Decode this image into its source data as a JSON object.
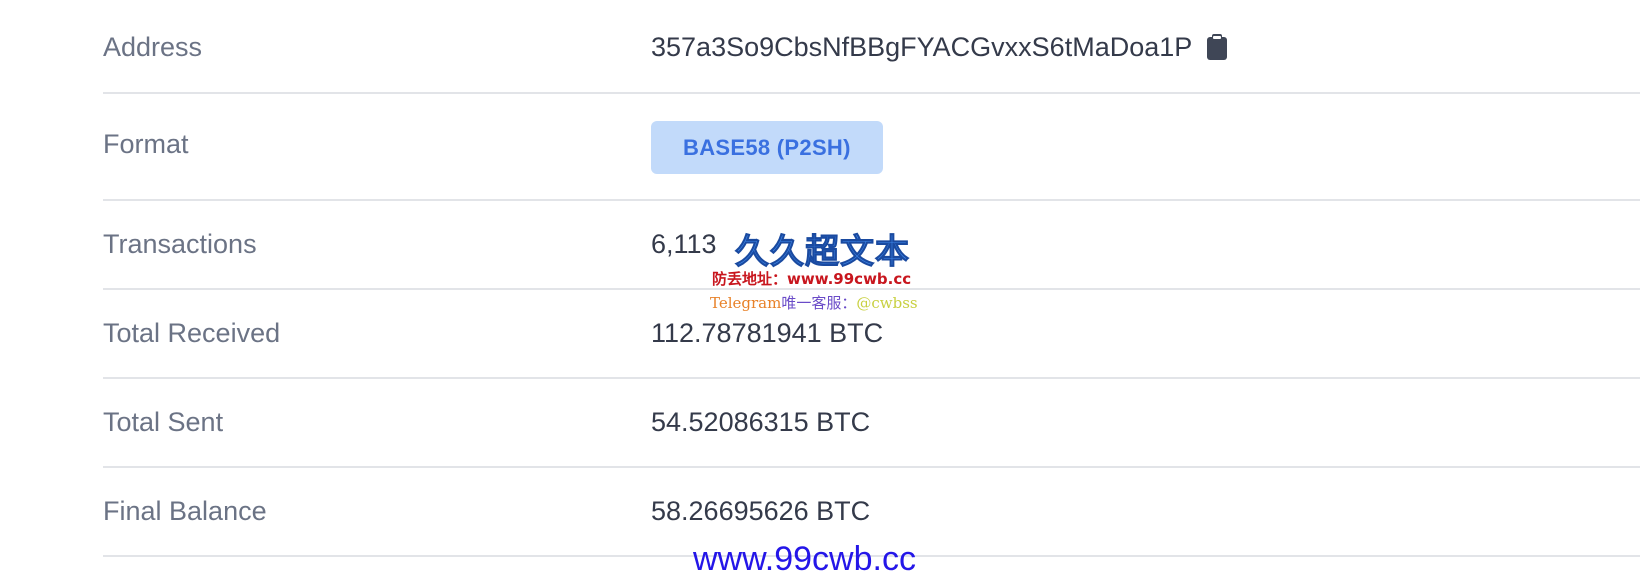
{
  "rows": [
    {
      "label": "Address",
      "value": "357a3So9CbsNfBBgFYACGvxxS6tMaDoa1P"
    },
    {
      "label": "Format",
      "value": "BASE58 (P2SH)"
    },
    {
      "label": "Transactions",
      "value": "6,113"
    },
    {
      "label": "Total Received",
      "value": "112.78781941 BTC"
    },
    {
      "label": "Total Sent",
      "value": "54.52086315 BTC"
    },
    {
      "label": "Final Balance",
      "value": "58.26695626 BTC"
    }
  ],
  "icons": {
    "copy": "clipboard-icon"
  },
  "colors": {
    "badge_bg": "#c2dafa",
    "badge_text": "#3a70e0",
    "label": "#6b7385",
    "value": "#343a4a"
  },
  "watermark": {
    "logo": "久久超文本",
    "line1": "防丢地址：www.99cwb.cc",
    "telegram": "Telegram",
    "support": "唯一客服：",
    "handle": "@cwbss",
    "footer": "www.99cwb.cc"
  }
}
